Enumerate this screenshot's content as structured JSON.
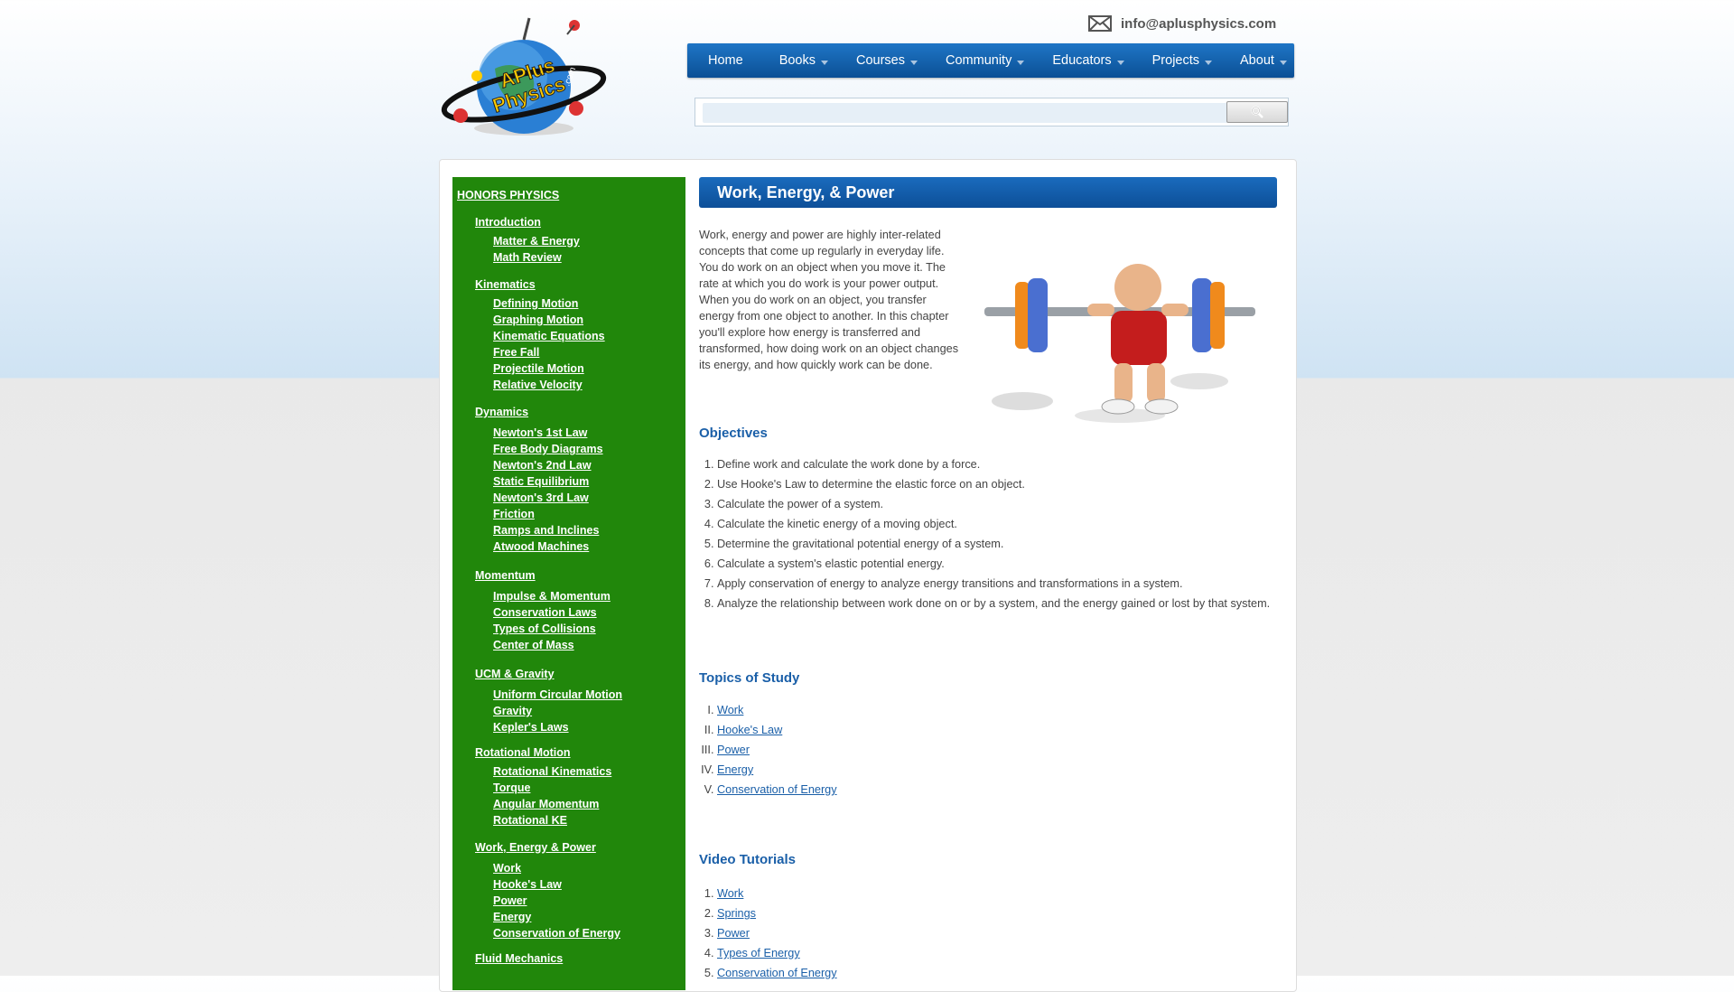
{
  "header": {
    "contact_email": "info@aplusphysics.com",
    "logo_text_line1": "APlus",
    "logo_text_line2": "Physics",
    "logo_text_dotcom": ".com"
  },
  "nav": {
    "items": [
      {
        "label": "Home",
        "has_dropdown": false
      },
      {
        "label": "Books",
        "has_dropdown": true
      },
      {
        "label": "Courses",
        "has_dropdown": true
      },
      {
        "label": "Community",
        "has_dropdown": true
      },
      {
        "label": "Educators",
        "has_dropdown": true
      },
      {
        "label": "Projects",
        "has_dropdown": true
      },
      {
        "label": "About",
        "has_dropdown": true
      }
    ]
  },
  "search": {
    "value": "",
    "button_icon": "search-icon"
  },
  "sidebar": {
    "title": "HONORS PHYSICS",
    "sections": [
      {
        "label": "Introduction",
        "items": [
          "Matter & Energy",
          "Math Review"
        ]
      },
      {
        "label": "Kinematics",
        "items": [
          "Defining Motion",
          "Graphing Motion",
          "Kinematic Equations",
          "Free Fall",
          "Projectile Motion",
          "Relative Velocity"
        ]
      },
      {
        "label": "Dynamics",
        "items": [
          "Newton's 1st Law",
          "Free Body Diagrams",
          "Newton's 2nd Law",
          "Static Equilibrium",
          "Newton's 3rd Law",
          "Friction",
          "Ramps and Inclines",
          "Atwood Machines"
        ]
      },
      {
        "label": "Momentum",
        "items": [
          "Impulse & Momentum",
          "Conservation Laws",
          "Types of Collisions",
          "Center of Mass"
        ]
      },
      {
        "label": "UCM & Gravity",
        "items": [
          "Uniform Circular Motion",
          "Gravity",
          "Kepler's Laws"
        ]
      },
      {
        "label": "Rotational Motion",
        "items": [
          "Rotational Kinematics",
          "Torque",
          "Angular Momentum",
          "Rotational KE"
        ]
      },
      {
        "label": "Work, Energy & Power",
        "items": [
          "Work",
          "Hooke's Law",
          "Power",
          "Energy",
          "Conservation of Energy"
        ]
      },
      {
        "label": "Fluid Mechanics",
        "items": []
      }
    ]
  },
  "main": {
    "title": "Work, Energy, & Power",
    "intro": "Work, energy and power are highly inter-related concepts that come up regularly in everyday life. You do work on an object when you move it. The rate at which you do work is your power output. When you do work on an object, you transfer energy from one object to another. In this chapter you'll explore how energy is transferred and transformed, how doing work on an object changes its energy, and how quickly work can be done.",
    "objectives_heading": "Objectives",
    "objectives": [
      "Define work and calculate the work done by a force.",
      "Use Hooke's Law to determine the elastic force on an object.",
      "Calculate the power of a system.",
      "Calculate the kinetic energy of a moving object.",
      "Determine the gravitational potential energy of a system.",
      "Calculate a system's elastic potential energy.",
      "Apply conservation of energy to analyze energy transitions and transformations in a system.",
      "Analyze the relationship between work done on or by a system, and the energy gained or lost by that system."
    ],
    "topics_heading": "Topics of Study",
    "topics": [
      "Work",
      "Hooke's Law",
      "Power",
      "Energy",
      "Conservation of Energy"
    ],
    "videos_heading": "Video Tutorials",
    "videos": [
      "Work",
      "Springs",
      "Power",
      "Types of Energy",
      "Conservation of Energy"
    ]
  }
}
